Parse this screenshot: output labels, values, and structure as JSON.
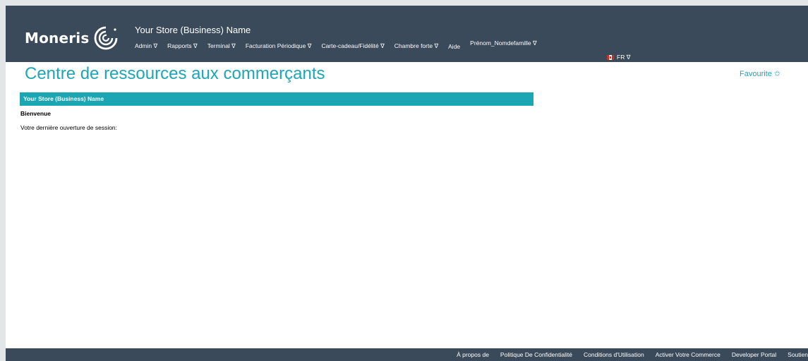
{
  "header": {
    "logo_text": "Moneris",
    "store_name": "Your Store (Business) Name",
    "nav": [
      {
        "label": "Admin ∇"
      },
      {
        "label": "Rapports ∇"
      },
      {
        "label": "Terminal ∇"
      },
      {
        "label": "Facturation Périodique ∇"
      },
      {
        "label": "Carte-cadeau/Fidélité ∇"
      },
      {
        "label": "Chambre forte ∇"
      },
      {
        "label": "Aide"
      },
      {
        "label": "Prénom_Nomdefamille ∇"
      }
    ],
    "language": "FR ∇"
  },
  "main": {
    "title": "Centre de ressources aux commerçants",
    "favourite": "Favourite ✩",
    "store_bar": "Your Store (Business) Name",
    "welcome": "Bienvenue",
    "last_login": "Votre dernière ouverture de session:"
  },
  "footer": {
    "links": [
      {
        "label": "À propos de"
      },
      {
        "label": "Politique De Confidentialité"
      },
      {
        "label": "Conditions d'Utilisation"
      },
      {
        "label": "Activer Votre Commerce"
      },
      {
        "label": "Developer Portal"
      },
      {
        "label": "Soutien"
      }
    ]
  },
  "colors": {
    "header_bg": "#3a4a5a",
    "accent": "#1da6b4",
    "store_bar_bg": "#1aa6b3"
  },
  "icons": {
    "logo": "moneris-swirl-icon",
    "flag": "canada-flag-icon",
    "favourite": "star-outline-icon"
  }
}
